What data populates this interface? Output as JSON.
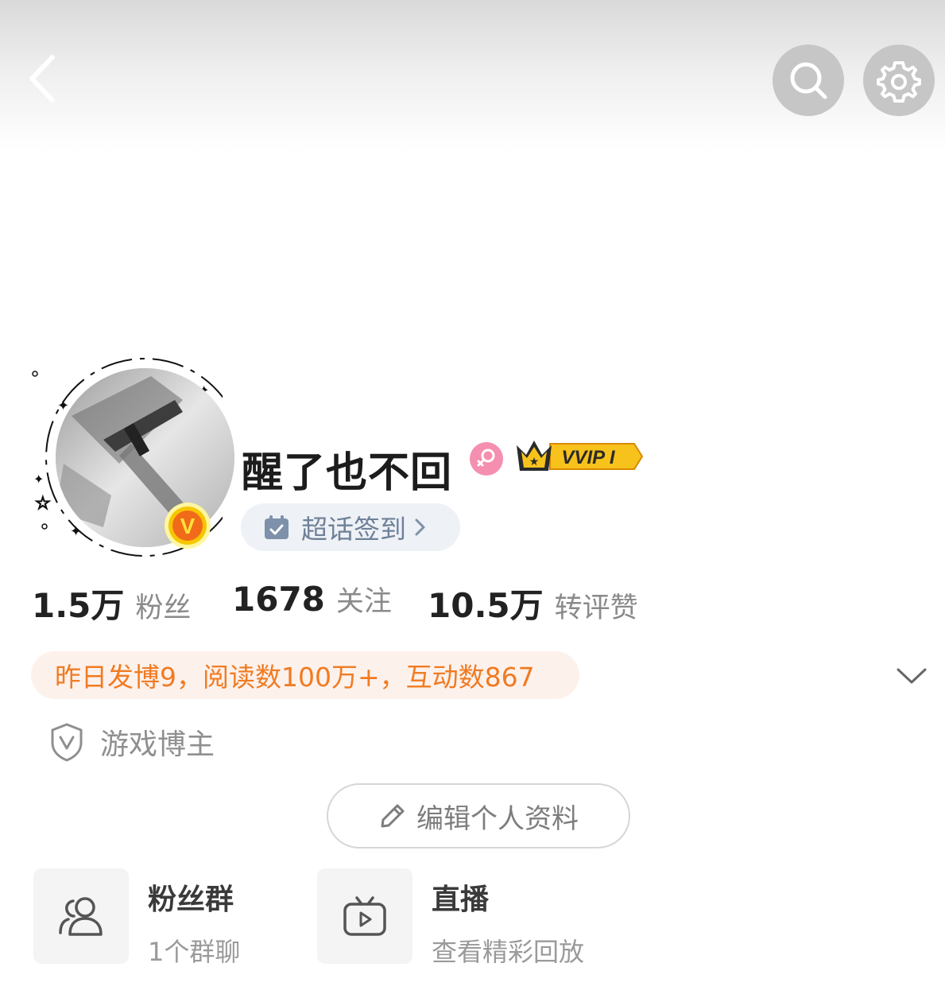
{
  "header": {
    "back_icon": "chevron-left-icon",
    "search_icon": "search-icon",
    "settings_icon": "gear-icon"
  },
  "profile": {
    "username": "醒了也不回",
    "gender_icon": "female-icon",
    "vip_badge": "VVIP I",
    "verified_badge": "V",
    "checkin_label": "超话签到"
  },
  "stats": [
    {
      "value": "1.5万",
      "label": "粉丝"
    },
    {
      "value": "1678",
      "label": "关注"
    },
    {
      "value": "10.5万",
      "label": "转评赞"
    }
  ],
  "summary": {
    "text": "昨日发博9，阅读数100万+，互动数867"
  },
  "tag": {
    "label": "游戏博主",
    "icon": "shield-v-icon"
  },
  "edit_profile": {
    "label": "编辑个人资料"
  },
  "features": [
    {
      "title": "粉丝群",
      "subtitle": "1个群聊",
      "icon": "group-icon"
    },
    {
      "title": "直播",
      "subtitle": "查看精彩回放",
      "icon": "tv-icon"
    }
  ],
  "colors": {
    "accent_orange": "#f07b22",
    "summary_bg": "#fdf1ec",
    "checkin_text": "#6f8198",
    "vip_gold": "#f5b400",
    "gender_pink": "#f58fb0"
  }
}
